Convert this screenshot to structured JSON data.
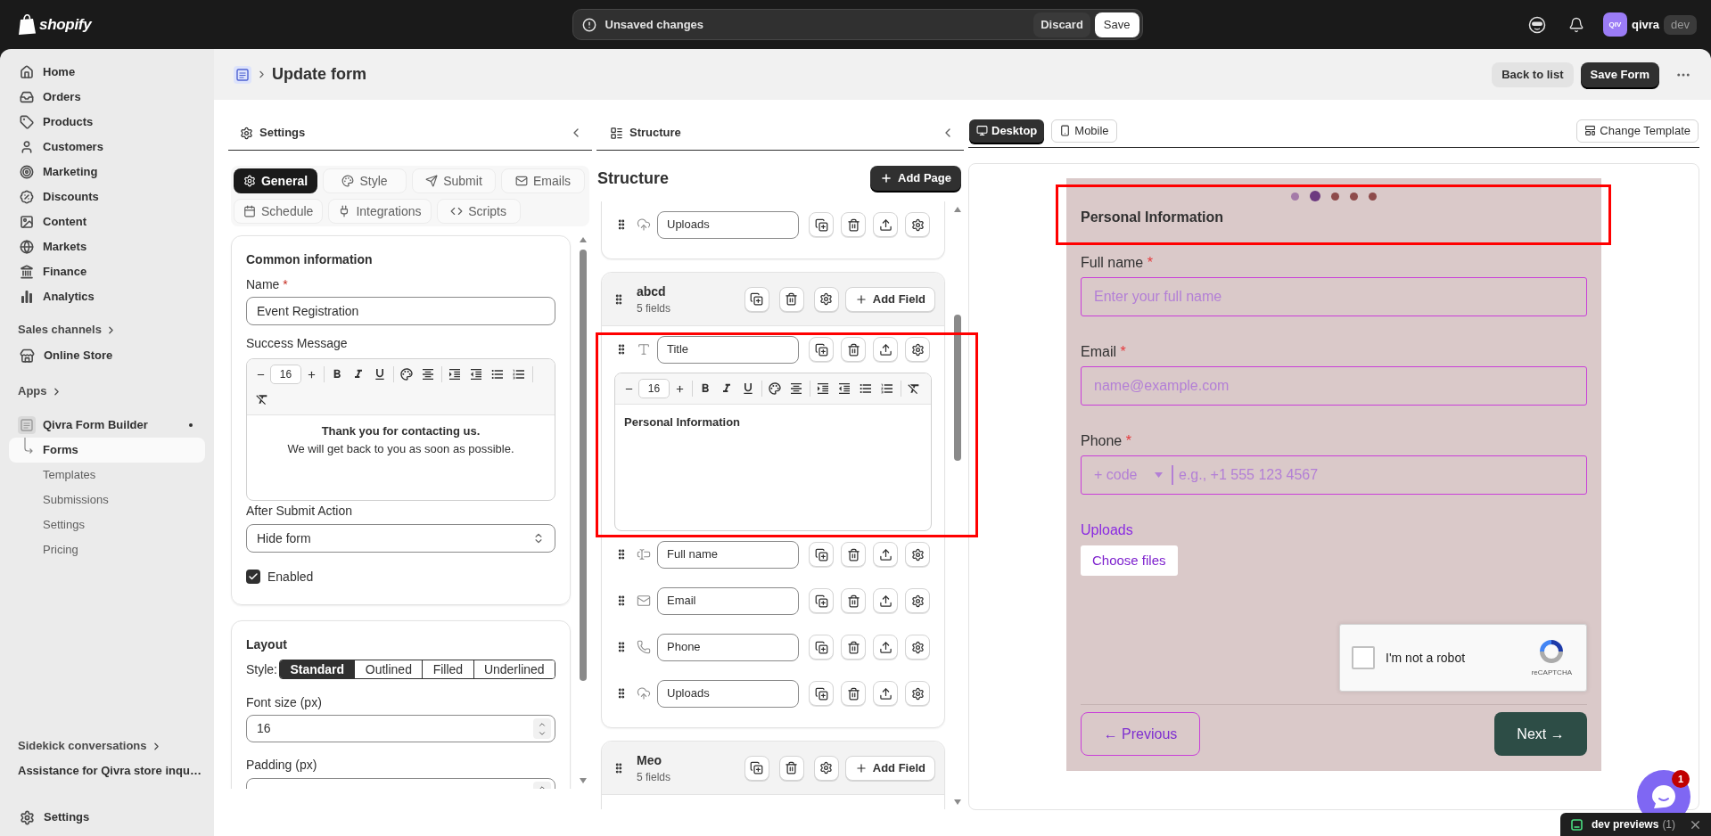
{
  "top_bar": {
    "logo_text": "shopify",
    "unsaved_bar": {
      "message": "Unsaved changes",
      "discard": "Discard",
      "save": "Save"
    },
    "account": {
      "avatar": "QIV",
      "name": "qivra",
      "badge": "dev"
    }
  },
  "sidebar": {
    "items": [
      {
        "label": "Home",
        "selected": false
      },
      {
        "label": "Orders",
        "selected": false
      },
      {
        "label": "Products",
        "selected": false
      },
      {
        "label": "Customers",
        "selected": false
      },
      {
        "label": "Marketing",
        "selected": false
      },
      {
        "label": "Discounts",
        "selected": false
      },
      {
        "label": "Content",
        "selected": false
      },
      {
        "label": "Markets",
        "selected": false
      },
      {
        "label": "Finance",
        "selected": false
      },
      {
        "label": "Analytics",
        "selected": false
      }
    ],
    "sales_channels": {
      "title": "Sales channels",
      "items": [
        {
          "label": "Online Store",
          "selected": false
        }
      ]
    },
    "apps": {
      "title": "Apps",
      "items": [
        {
          "label": "Qivra Form Builder",
          "selected": false,
          "children": [
            {
              "label": "Forms",
              "selected": true
            },
            {
              "label": "Templates",
              "selected": false
            },
            {
              "label": "Submissions",
              "selected": false
            },
            {
              "label": "Settings",
              "selected": false
            },
            {
              "label": "Pricing",
              "selected": false
            }
          ]
        }
      ]
    },
    "sidekick": {
      "title": "Sidekick conversations",
      "items": [
        {
          "label": "Assistance for Qivra store inqu…",
          "selected": false
        }
      ]
    },
    "footer": {
      "label": "Settings",
      "selected": false
    }
  },
  "page_header": {
    "title": "Update form",
    "back": "Back to list",
    "save": "Save Form"
  },
  "settings_panel": {
    "title": "Settings",
    "tabs": [
      {
        "label": "General",
        "selected": true
      },
      {
        "label": "Style",
        "selected": false
      },
      {
        "label": "Submit",
        "selected": false
      },
      {
        "label": "Emails",
        "selected": false
      },
      {
        "label": "Schedule",
        "selected": false
      },
      {
        "label": "Integrations",
        "selected": false
      },
      {
        "label": "Scripts",
        "selected": false
      }
    ],
    "common_card": {
      "heading": "Common information",
      "name_label": "Name",
      "required_mark": "*",
      "name_value": "Event Registration",
      "message_label": "Success Message",
      "editor": {
        "font_size": "16",
        "paragraphs": [
          {
            "text": "Thank you for contacting us.",
            "bold": true
          },
          {
            "text": "We will get back to you as soon as possible.",
            "bold": false
          }
        ]
      },
      "action_label": "After Submit Action",
      "action_value": "Hide form",
      "enabled": {
        "label": "Enabled",
        "checked": true
      }
    },
    "layout_card": {
      "heading": "Layout",
      "style_label": "Style:",
      "style_options": [
        {
          "label": "Standard",
          "selected": true
        },
        {
          "label": "Outlined",
          "selected": false
        },
        {
          "label": "Filled",
          "selected": false
        },
        {
          "label": "Underlined",
          "selected": false
        }
      ],
      "font_size_label": "Font size (px)",
      "font_size_value": "16",
      "padding_label": "Padding (px)"
    }
  },
  "structure_panel": {
    "title": "Structure",
    "heading": "Structure",
    "add_page": "Add Page",
    "pages": [
      {
        "fields": [
          {
            "kind": "upload",
            "label": "Uploads",
            "expanded": false,
            "highlighted": false
          }
        ]
      },
      {
        "name": "abcd",
        "count": "5 fields",
        "add_field": "Add Field",
        "fields": [
          {
            "kind": "title",
            "label": "Title",
            "expanded": true,
            "highlighted": true,
            "editor": {
              "font_size": "16",
              "paragraphs": [
                {
                  "text": "Personal Information",
                  "bold": true
                }
              ]
            }
          },
          {
            "kind": "text",
            "label": "Full name",
            "expanded": false,
            "highlighted": false
          },
          {
            "kind": "email",
            "label": "Email",
            "expanded": false,
            "highlighted": false
          },
          {
            "kind": "phone",
            "label": "Phone",
            "expanded": false,
            "highlighted": false
          },
          {
            "kind": "upload",
            "label": "Uploads",
            "expanded": false,
            "highlighted": false
          }
        ]
      },
      {
        "name": "Meo",
        "count": "5 fields",
        "add_field": "Add Field"
      }
    ]
  },
  "preview_panel": {
    "views": [
      {
        "label": "Desktop",
        "selected": true
      },
      {
        "label": "Mobile",
        "selected": false
      }
    ],
    "change_template": "Change Template",
    "form": {
      "steps": [
        {
          "color": "#a47aa8",
          "selected": false
        },
        {
          "color": "#6d3a80",
          "selected": true
        },
        {
          "color": "#8e4b4b",
          "selected": false
        },
        {
          "color": "#8e4b4b",
          "selected": false
        },
        {
          "color": "#8e4b4b",
          "selected": false
        }
      ],
      "title": "Personal Information",
      "title_highlighted": true,
      "fields": [
        {
          "kind": "text",
          "label": "Full name",
          "required_mark": "*",
          "placeholder": "Enter your full name"
        },
        {
          "kind": "email",
          "label": "Email",
          "required_mark": "*",
          "placeholder": "name@example.com"
        },
        {
          "kind": "phone",
          "label": "Phone",
          "required_mark": "*",
          "code_placeholder": "+ code",
          "placeholder": "e.g., +1 555 123 4567"
        },
        {
          "kind": "upload",
          "label": "Uploads",
          "button": "Choose files"
        }
      ],
      "captcha": {
        "label": "I'm not a robot",
        "brand": "reCAPTCHA",
        "checked": false
      },
      "previous": "← Previous",
      "next": "Next →"
    }
  },
  "chat_widget": {
    "badge": "1"
  },
  "dev_previews": {
    "label": "dev previews",
    "count": "(1)"
  }
}
